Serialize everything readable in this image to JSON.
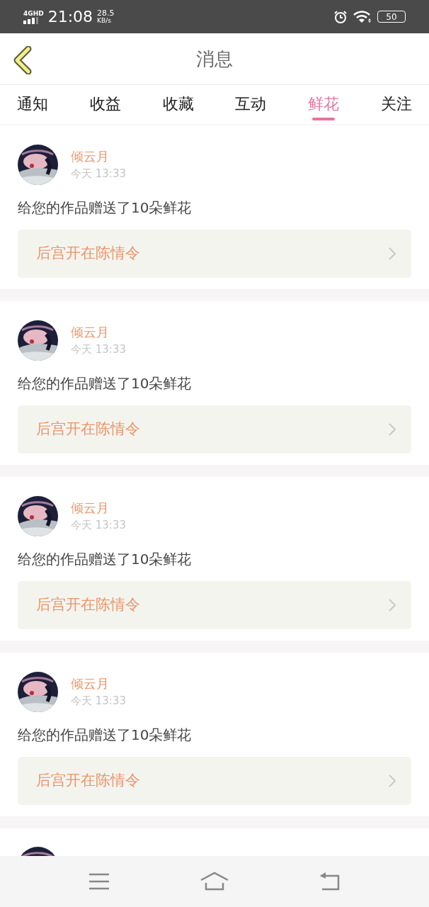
{
  "status_bar": {
    "network": "4GHD",
    "time": "21:08",
    "speed_value": "28.5",
    "speed_unit": "KB/s",
    "battery": "50"
  },
  "header": {
    "title": "消息"
  },
  "tabs": [
    {
      "label": "通知",
      "selected": false
    },
    {
      "label": "收益",
      "selected": false
    },
    {
      "label": "收藏",
      "selected": false
    },
    {
      "label": "互动",
      "selected": false
    },
    {
      "label": "鲜花",
      "selected": true
    },
    {
      "label": "关注",
      "selected": false
    }
  ],
  "messages": [
    {
      "kind": "full",
      "sender": "倾云月",
      "time": "今天 13:33",
      "text": "给您的作品赠送了10朵鲜花",
      "work": "后宫开在陈情令"
    },
    {
      "kind": "full",
      "sender": "倾云月",
      "time": "今天 13:33",
      "text": "给您的作品赠送了10朵鲜花",
      "work": "后宫开在陈情令"
    },
    {
      "kind": "full",
      "sender": "倾云月",
      "time": "今天 13:33",
      "text": "给您的作品赠送了10朵鲜花",
      "work": "后宫开在陈情令"
    },
    {
      "kind": "full",
      "sender": "倾云月",
      "time": "今天 13:33",
      "text": "给您的作品赠送了10朵鲜花",
      "work": "后宫开在陈情令"
    },
    {
      "kind": "cut"
    }
  ]
}
